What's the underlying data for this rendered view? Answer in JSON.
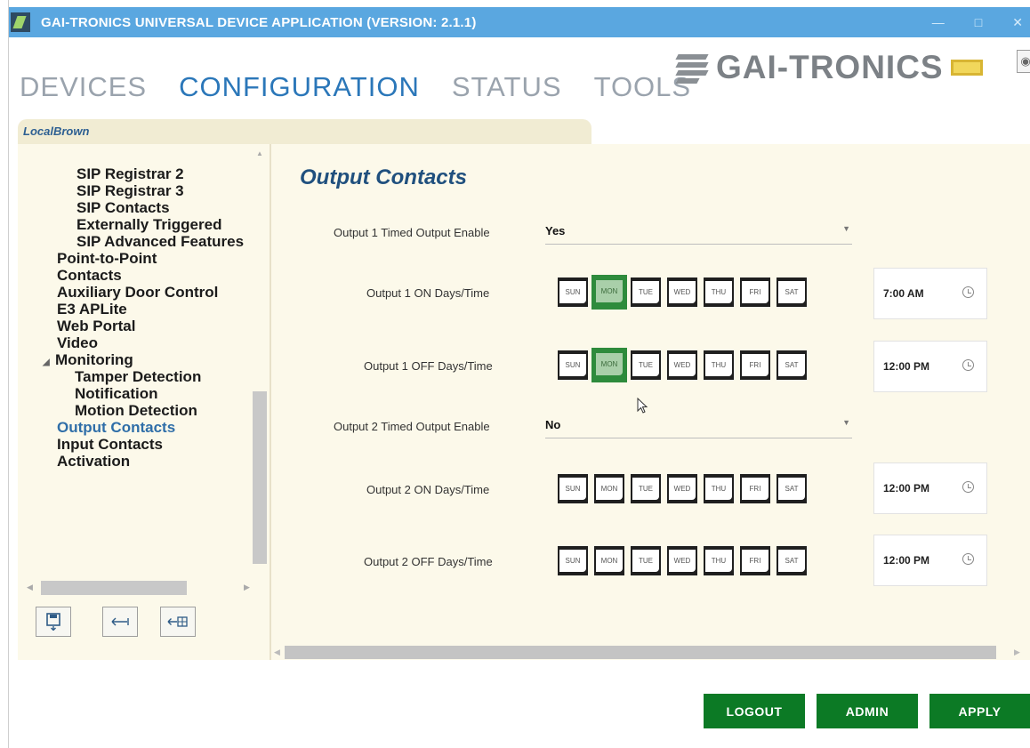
{
  "window": {
    "title": "GAI-TRONICS UNIVERSAL DEVICE APPLICATION (VERSION: 2.1.1)"
  },
  "nav": {
    "tabs": [
      "DEVICES",
      "CONFIGURATION",
      "STATUS",
      "TOOLS"
    ],
    "active": "CONFIGURATION"
  },
  "logo": {
    "text": "GAI-TRONICS"
  },
  "device": {
    "name": "LocalBrown"
  },
  "sidebar": {
    "items": [
      {
        "label": "SIP Registrar 2"
      },
      {
        "label": "SIP Registrar 3"
      },
      {
        "label": "SIP Contacts"
      },
      {
        "label": "Externally Triggered"
      },
      {
        "label": "SIP Advanced Features"
      },
      {
        "label": "Point-to-Point"
      },
      {
        "label": "Contacts"
      },
      {
        "label": "Auxiliary Door Control"
      },
      {
        "label": "E3 APLite"
      },
      {
        "label": "Web Portal"
      },
      {
        "label": "Video"
      },
      {
        "label": "Monitoring"
      },
      {
        "label": "Tamper Detection"
      },
      {
        "label": "Notification"
      },
      {
        "label": "Motion Detection"
      },
      {
        "label": "Output Contacts"
      },
      {
        "label": "Input Contacts"
      },
      {
        "label": "Activation"
      }
    ],
    "selected": "Output Contacts"
  },
  "content": {
    "title": "Output Contacts",
    "day_names": [
      "SUN",
      "MON",
      "TUE",
      "WED",
      "THU",
      "FRI",
      "SAT"
    ],
    "fields": {
      "out1_enable": {
        "label": "Output 1 Timed Output Enable",
        "value": "Yes"
      },
      "out1_on": {
        "label": "Output 1 ON Days/Time",
        "time": "7:00 AM",
        "selected_days": [
          "MON"
        ]
      },
      "out1_off": {
        "label": "Output 1 OFF Days/Time",
        "time": "12:00 PM",
        "selected_days": [
          "MON"
        ]
      },
      "out2_enable": {
        "label": "Output 2 Timed Output Enable",
        "value": "No"
      },
      "out2_on": {
        "label": "Output 2 ON Days/Time",
        "time": "12:00 PM",
        "selected_days": []
      },
      "out2_off": {
        "label": "Output 2 OFF Days/Time",
        "time": "12:00 PM",
        "selected_days": []
      }
    }
  },
  "buttons": {
    "logout": "LOGOUT",
    "admin": "ADMIN",
    "apply": "APPLY"
  },
  "colors": {
    "titlebar": "#5aa7e0",
    "accent_blue": "#2b77b9",
    "panel": "#fcf9ea",
    "button_green": "#0c7a25",
    "selected_day": "#2e8b3c"
  },
  "icons": [
    "save-to-device-icon",
    "back-arrow-icon",
    "back-grid-icon",
    "clock-icon",
    "dropdown-chevron-icon"
  ]
}
